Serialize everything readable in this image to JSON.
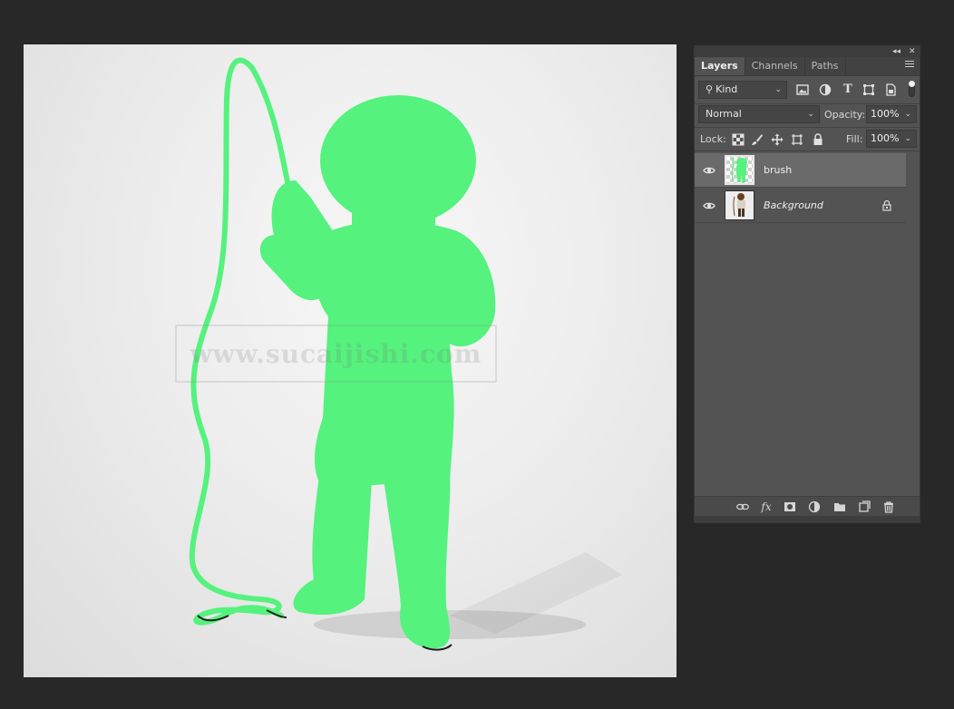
{
  "canvas": {
    "watermark": "www.sucaijishi.com",
    "fill_color": "#55f27e"
  },
  "panel": {
    "collapse_glyph": "◂◂",
    "close_glyph": "✕",
    "tabs": [
      {
        "label": "Layers",
        "active": true
      },
      {
        "label": "Channels",
        "active": false
      },
      {
        "label": "Paths",
        "active": false
      }
    ],
    "filter": {
      "search_glyph": "⚲",
      "kind_label": "Kind",
      "icons": [
        "image-filter-icon",
        "adjustment-filter-icon",
        "type-filter-icon",
        "shape-filter-icon",
        "smart-object-filter-icon"
      ],
      "type_glyph": "T"
    },
    "blend_mode": "Normal",
    "opacity_label": "Opacity:",
    "opacity_value": "100%",
    "lock_label": "Lock:",
    "fill_label": "Fill:",
    "fill_value": "100%",
    "layers": [
      {
        "name": "brush",
        "selected": true,
        "visible": true,
        "locked": false
      },
      {
        "name": "Background",
        "selected": false,
        "visible": true,
        "locked": true
      }
    ],
    "bottom_icons": [
      "link-icon",
      "fx-icon",
      "mask-icon",
      "adjustment-icon",
      "group-folder-icon",
      "new-layer-icon",
      "trash-icon"
    ],
    "fx_label": "fx",
    "chevron": "⌄"
  }
}
